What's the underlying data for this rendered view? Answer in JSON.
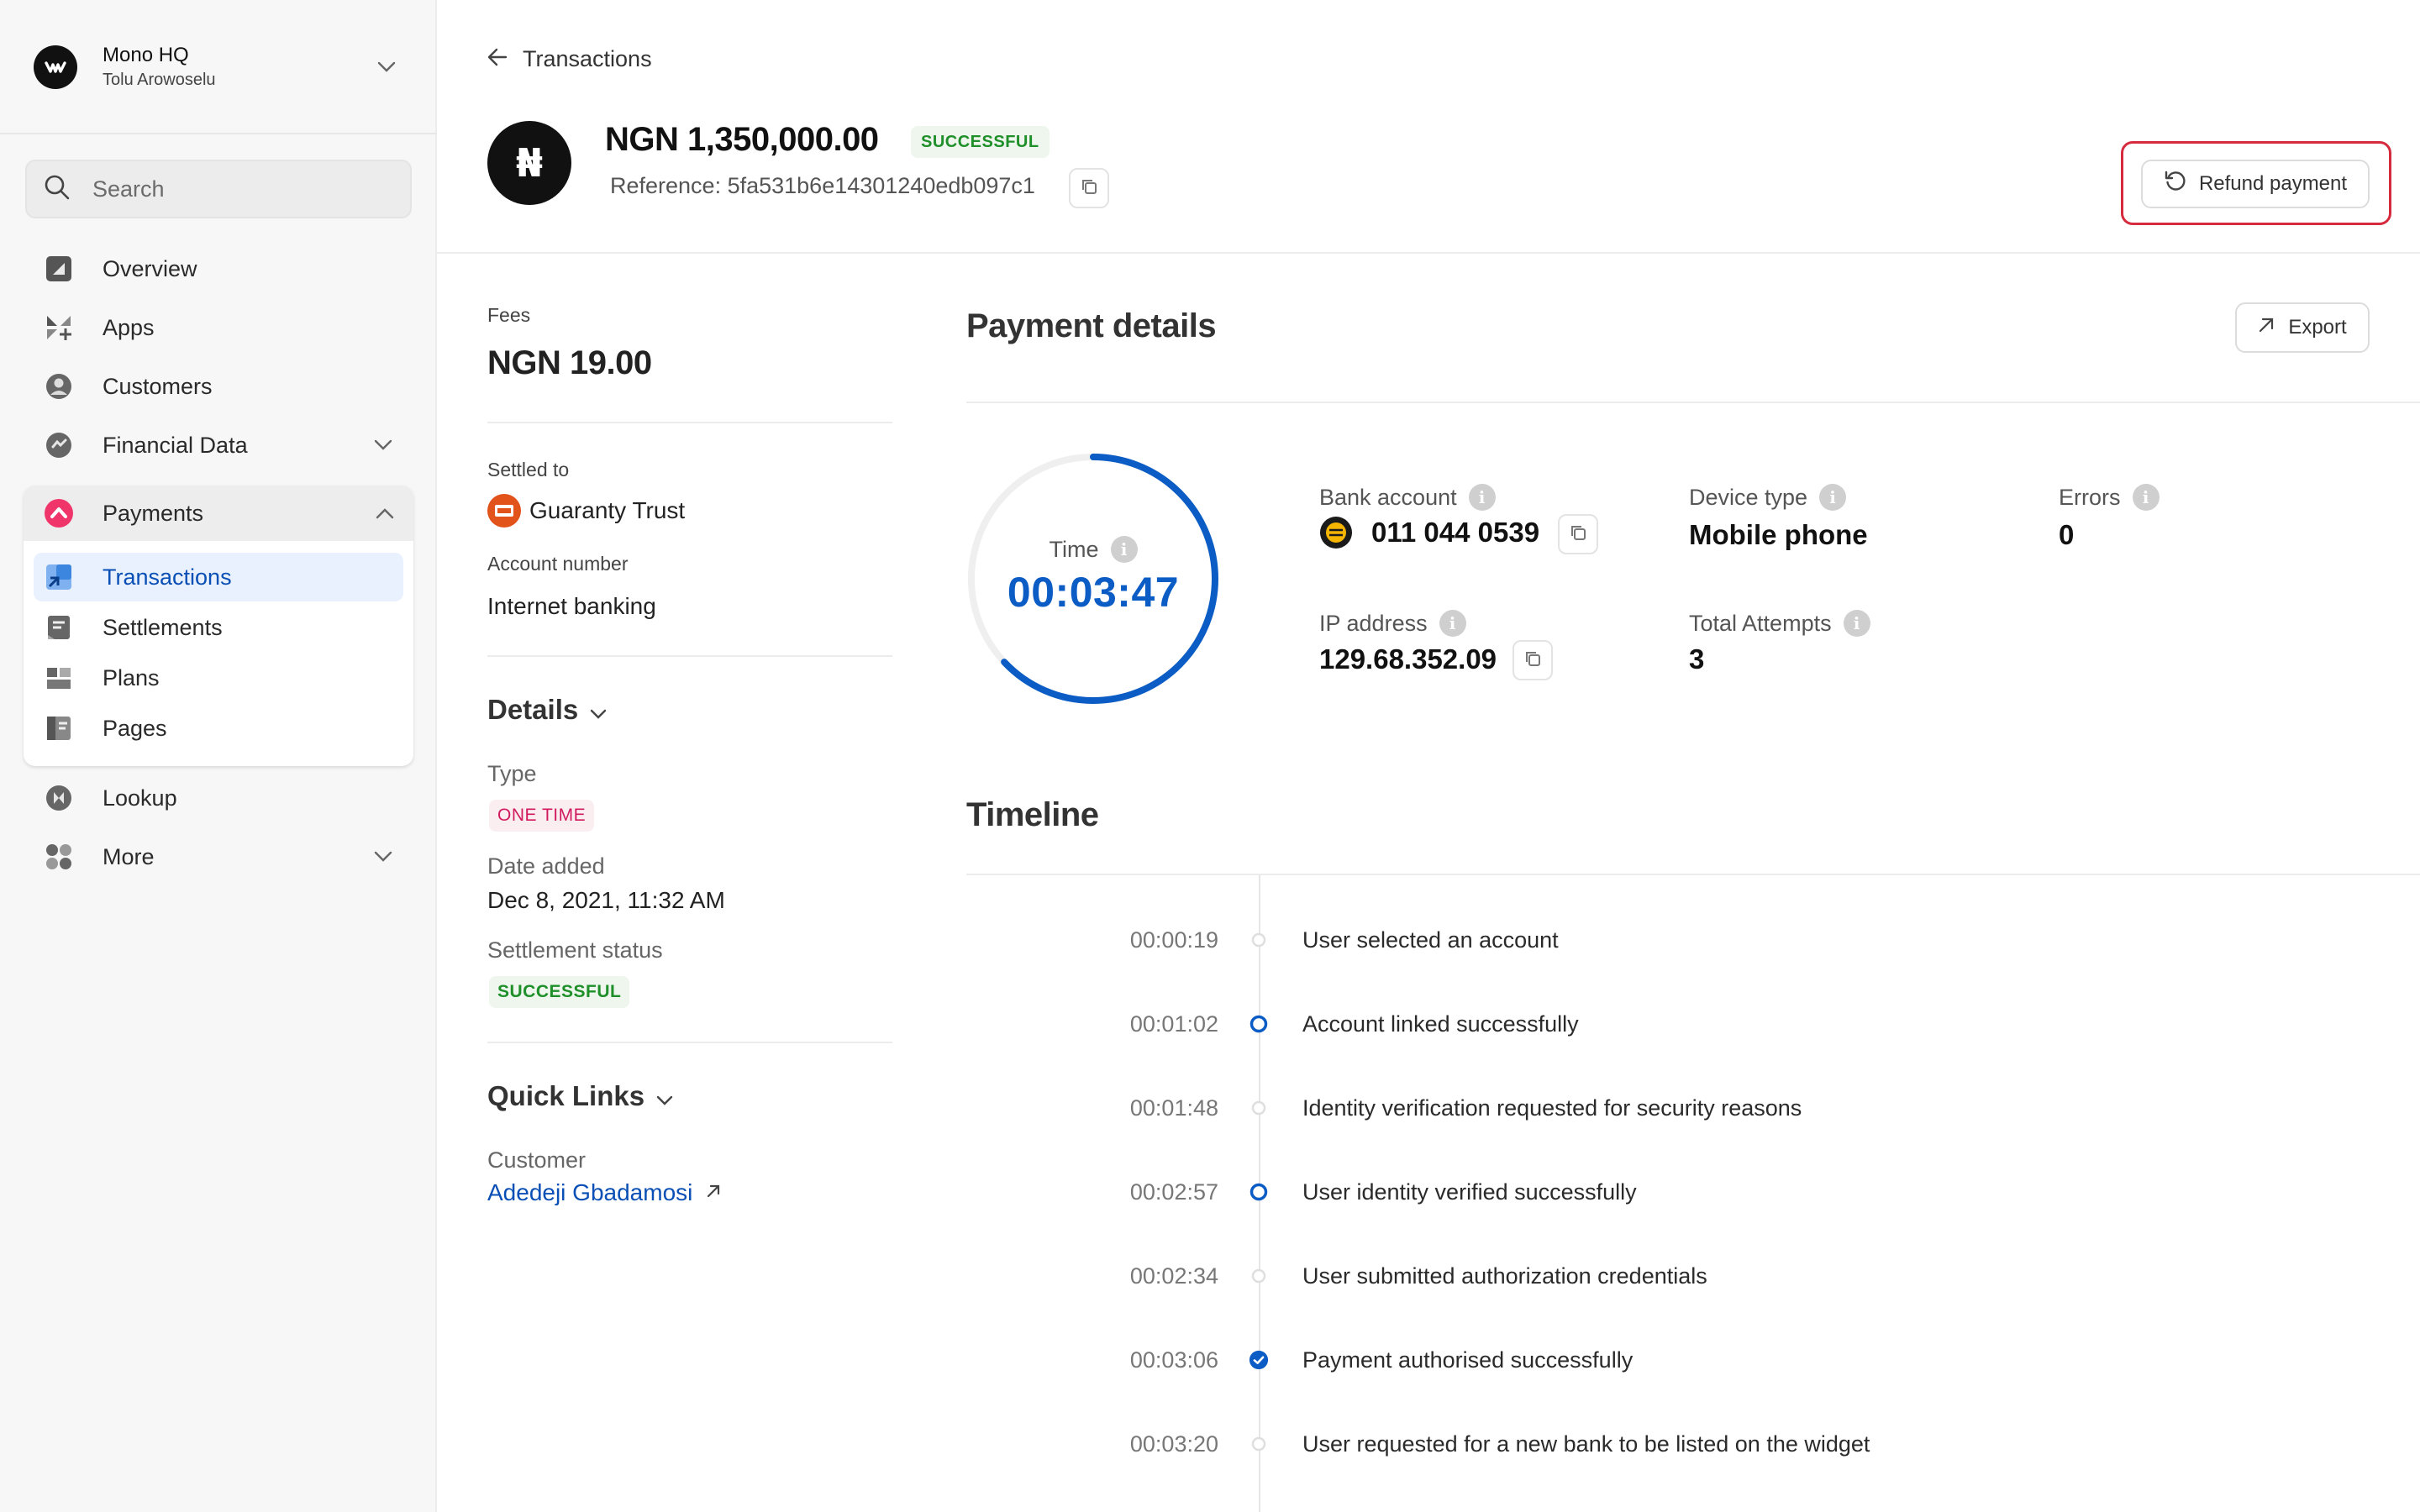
{
  "sidebar": {
    "org_name": "Mono HQ",
    "org_user": "Tolu Arowoselu",
    "search_placeholder": "Search",
    "items": [
      {
        "label": "Overview",
        "icon": "overview-icon"
      },
      {
        "label": "Apps",
        "icon": "apps-icon"
      },
      {
        "label": "Customers",
        "icon": "customers-icon"
      },
      {
        "label": "Financial Data",
        "icon": "financial-data-icon"
      },
      {
        "label": "Payments",
        "icon": "payments-icon"
      },
      {
        "label": "Lookup",
        "icon": "lookup-icon"
      },
      {
        "label": "More",
        "icon": "more-icon"
      }
    ],
    "payments_sub": [
      {
        "label": "Transactions",
        "active": true
      },
      {
        "label": "Settlements",
        "active": false
      },
      {
        "label": "Plans",
        "active": false
      },
      {
        "label": "Pages",
        "active": false
      }
    ]
  },
  "header": {
    "back_label": "Transactions",
    "currency_symbol": "₦",
    "amount": "NGN 1,350,000.00",
    "status": "SUCCESSFUL",
    "reference": "Reference: 5fa531b6e14301240edb097c1",
    "refund_label": "Refund payment"
  },
  "info": {
    "fees_label": "Fees",
    "fees_value": "NGN 19.00",
    "settled_label": "Settled to",
    "bank_name": "Guaranty Trust",
    "account_label": "Account number",
    "account_value": "Internet banking",
    "details_title": "Details",
    "type_label": "Type",
    "type_value": "ONE TIME",
    "date_label": "Date added",
    "date_value": "Dec 8, 2021, 11:32 AM",
    "settlement_label": "Settlement status",
    "settlement_value": "SUCCESSFUL",
    "quick_links_title": "Quick Links",
    "customer_label": "Customer",
    "customer_name": "Adedeji Gbadamosi"
  },
  "payment_details": {
    "title": "Payment details",
    "export_label": "Export",
    "timer_label": "Time",
    "timer_value": "00:03:47",
    "timer_progress": 0.63,
    "bank_account_label": "Bank account",
    "bank_account_value": "011 044 0539",
    "ip_label": "IP address",
    "ip_value": "129.68.352.09",
    "device_label": "Device type",
    "device_value": "Mobile phone",
    "attempts_label": "Total Attempts",
    "attempts_value": "3",
    "errors_label": "Errors",
    "errors_value": "0"
  },
  "timeline": {
    "title": "Timeline",
    "events": [
      {
        "time": "00:00:19",
        "text": "User selected an account",
        "status": "pending"
      },
      {
        "time": "00:01:02",
        "text": "Account linked successfully",
        "status": "success"
      },
      {
        "time": "00:01:48",
        "text": "Identity verification requested for security reasons",
        "status": "pending"
      },
      {
        "time": "00:02:57",
        "text": "User identity verified successfully",
        "status": "success"
      },
      {
        "time": "00:02:34",
        "text": "User submitted authorization credentials",
        "status": "pending"
      },
      {
        "time": "00:03:06",
        "text": "Payment authorised successfully",
        "status": "complete"
      },
      {
        "time": "00:03:20",
        "text": "User requested for a new bank to be listed on the widget",
        "status": "pending"
      }
    ]
  },
  "colors": {
    "accent": "#0b5cc4",
    "success": "#1f8f2a",
    "pink": "#d11b5e",
    "highlight": "#d62b3e"
  }
}
